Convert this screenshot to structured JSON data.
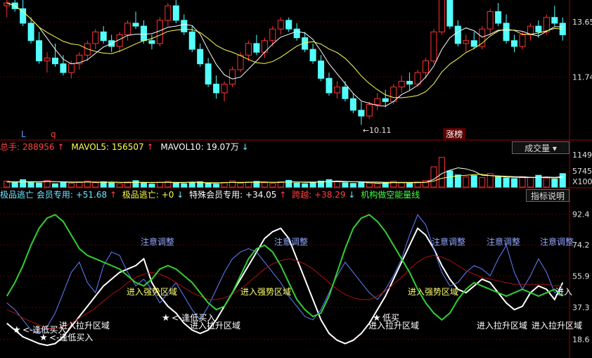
{
  "colors": {
    "up": "#ff3232",
    "down": "#54ffff",
    "ma_white": "#ffffff",
    "ma_yellow": "#ffff50",
    "green": "#30d030",
    "blue": "#6080ff",
    "dark_red": "#b01010",
    "grid": "#5a0000",
    "text_axis": "#e0e0e0"
  },
  "price_panel": {
    "axis_labels": [
      "13.65",
      "11.74"
    ],
    "low_annotation": "10.11",
    "markers": [
      "L",
      "q",
      "L"
    ],
    "badge": "涨榜"
  },
  "volume_panel": {
    "header": {
      "hand_label": "总手:",
      "hand_value": "288956",
      "mavol5_label": "MAVOL5:",
      "mavol5_value": "156507",
      "mavol10_label": "MAVOL10:",
      "mavol10_value": "19.07万"
    },
    "dropdown_label": "成交量",
    "dropdown_icon": "chevron-down",
    "axis_labels": [
      "1149",
      "5745",
      "X100"
    ]
  },
  "indicator_panel": {
    "header": {
      "item1_label": "极品逃亡",
      "item2_label": "会员专用:",
      "item2_value": "+51.68",
      "item3_label": "极品逃亡:",
      "item3_value": "+0",
      "item4_label": "特殊会员专用:",
      "item4_value": "+34.05",
      "item5_label": "跨越:",
      "item5_value": "+38.29",
      "item6_label": "机构做空能量线"
    },
    "help_button": "指标说明",
    "axis_labels": [
      "92.4",
      "74.2",
      "55.9",
      "37.3",
      "18.6"
    ],
    "annotations": {
      "attention": "注意调整",
      "strong_zone": "进入强势区域",
      "pull_up_zone": "进入拉升区域",
      "low_buy_1": "逢低买入",
      "low_buy_2": "<-逢低买入",
      "low_buy_3": "<-逢低买入",
      "low_buy_4": "低买",
      "enter_short": "进入",
      "enter_cut": "进入拉升区域",
      "overflow_text": "进入拉升区域"
    }
  },
  "chart_data": [
    {
      "type": "candlestick",
      "title": "",
      "y_ticks": [
        13.65,
        11.74
      ],
      "ylim": [
        9.6,
        14.4
      ],
      "annotated_low": 10.11,
      "note": "daily candles with moving averages; values estimated",
      "candles": [
        [
          14.2,
          14.5,
          13.8,
          14.3
        ],
        [
          14.3,
          14.6,
          14.0,
          14.1
        ],
        [
          14.1,
          14.4,
          13.5,
          13.6
        ],
        [
          13.6,
          13.8,
          12.9,
          13.0
        ],
        [
          13.0,
          13.3,
          12.2,
          12.3
        ],
        [
          12.3,
          12.6,
          11.9,
          12.4
        ],
        [
          12.4,
          12.9,
          12.1,
          12.2
        ],
        [
          12.2,
          12.5,
          11.8,
          11.9
        ],
        [
          11.9,
          12.3,
          11.7,
          12.2
        ],
        [
          12.2,
          12.6,
          12.0,
          12.5
        ],
        [
          12.5,
          13.0,
          12.3,
          12.9
        ],
        [
          12.9,
          13.4,
          12.7,
          13.3
        ],
        [
          13.3,
          13.5,
          12.9,
          13.0
        ],
        [
          13.0,
          13.2,
          12.6,
          12.8
        ],
        [
          12.8,
          13.3,
          12.6,
          13.2
        ],
        [
          13.2,
          13.7,
          13.0,
          13.6
        ],
        [
          13.6,
          14.0,
          13.4,
          13.5
        ],
        [
          13.5,
          13.7,
          12.9,
          13.0
        ],
        [
          13.0,
          13.2,
          12.7,
          12.9
        ],
        [
          12.9,
          13.8,
          12.8,
          13.7
        ],
        [
          13.7,
          14.3,
          13.5,
          14.2
        ],
        [
          14.2,
          14.4,
          13.6,
          13.7
        ],
        [
          13.7,
          13.9,
          13.2,
          13.3
        ],
        [
          13.3,
          13.5,
          12.6,
          12.7
        ],
        [
          12.7,
          12.9,
          12.1,
          12.2
        ],
        [
          12.2,
          12.4,
          11.4,
          11.5
        ],
        [
          11.5,
          11.8,
          11.0,
          11.2
        ],
        [
          11.2,
          11.6,
          10.9,
          11.5
        ],
        [
          11.5,
          12.1,
          11.4,
          12.0
        ],
        [
          12.0,
          12.6,
          11.9,
          12.5
        ],
        [
          12.5,
          13.0,
          12.3,
          12.9
        ],
        [
          12.9,
          13.2,
          12.5,
          12.6
        ],
        [
          12.6,
          13.1,
          12.4,
          13.0
        ],
        [
          13.0,
          13.5,
          12.8,
          13.4
        ],
        [
          13.4,
          13.8,
          13.2,
          13.7
        ],
        [
          13.7,
          13.8,
          13.3,
          13.4
        ],
        [
          13.4,
          13.6,
          13.0,
          13.1
        ],
        [
          13.1,
          13.3,
          12.6,
          12.7
        ],
        [
          12.7,
          12.9,
          12.2,
          12.3
        ],
        [
          12.3,
          12.5,
          11.6,
          11.7
        ],
        [
          11.7,
          11.9,
          11.1,
          11.2
        ],
        [
          11.2,
          11.6,
          11.0,
          11.4
        ],
        [
          11.4,
          11.6,
          10.9,
          11.0
        ],
        [
          11.0,
          11.2,
          10.5,
          10.6
        ],
        [
          10.6,
          10.9,
          10.1,
          10.4
        ],
        [
          10.4,
          10.9,
          10.3,
          10.8
        ],
        [
          10.8,
          11.2,
          10.6,
          11.0
        ],
        [
          11.0,
          11.3,
          10.7,
          10.9
        ],
        [
          10.9,
          11.5,
          10.8,
          11.4
        ],
        [
          11.4,
          11.8,
          11.2,
          11.6
        ],
        [
          11.6,
          11.9,
          11.3,
          11.5
        ],
        [
          11.5,
          12.0,
          11.4,
          11.9
        ],
        [
          11.9,
          12.4,
          11.7,
          12.3
        ],
        [
          12.3,
          13.4,
          12.2,
          13.3
        ],
        [
          13.3,
          14.6,
          13.2,
          14.5
        ],
        [
          14.5,
          14.6,
          13.4,
          13.5
        ],
        [
          13.5,
          13.7,
          12.8,
          12.9
        ],
        [
          12.9,
          13.2,
          12.6,
          13.0
        ],
        [
          13.0,
          13.3,
          12.7,
          12.8
        ],
        [
          12.8,
          13.5,
          12.7,
          13.4
        ],
        [
          13.4,
          14.1,
          13.2,
          14.0
        ],
        [
          14.0,
          14.3,
          13.5,
          13.6
        ],
        [
          13.6,
          13.9,
          12.9,
          13.0
        ],
        [
          13.0,
          13.2,
          12.6,
          12.8
        ],
        [
          12.8,
          13.3,
          12.7,
          13.2
        ],
        [
          13.2,
          13.6,
          13.0,
          13.5
        ],
        [
          13.5,
          13.7,
          13.1,
          13.3
        ],
        [
          13.3,
          13.9,
          13.2,
          13.8
        ],
        [
          13.8,
          14.2,
          13.5,
          13.6
        ],
        [
          13.6,
          13.8,
          13.0,
          13.2
        ]
      ]
    },
    {
      "type": "bar",
      "title": "成交量",
      "y_ticks": [
        1149,
        5745
      ],
      "unit": "X100",
      "values": [
        18,
        14,
        22,
        16,
        12,
        20,
        10,
        15,
        11,
        14,
        18,
        13,
        16,
        12,
        10,
        15,
        19,
        13,
        9,
        14,
        17,
        12,
        10,
        13,
        16,
        11,
        9,
        14,
        18,
        12,
        15,
        17,
        13,
        11,
        16,
        20,
        12,
        10,
        14,
        18,
        22,
        16,
        13,
        11,
        15,
        12,
        10,
        14,
        17,
        13,
        11,
        15,
        19,
        60,
        88,
        48,
        36,
        30,
        34,
        28,
        40,
        32,
        27,
        25,
        30,
        29,
        35,
        27,
        24,
        40
      ],
      "ma_series": [
        {
          "name": "MAVOL5",
          "values": [
            16,
            16,
            16,
            16,
            16,
            17,
            16,
            15,
            14,
            14,
            15,
            14,
            14,
            15,
            14,
            13,
            14,
            14,
            13,
            14,
            14,
            13,
            13,
            15,
            14,
            12,
            12,
            13,
            14,
            13,
            14,
            15,
            15,
            14,
            14,
            16,
            15,
            14,
            14,
            15,
            17,
            18,
            17,
            16,
            15,
            13,
            12,
            12,
            13,
            13,
            13,
            13,
            14,
            23,
            40,
            50,
            57,
            54,
            47,
            35,
            34,
            33,
            32,
            31,
            31,
            29,
            29,
            30,
            29,
            31
          ]
        },
        {
          "name": "MAVOL10",
          "values": [
            15,
            15,
            15,
            15,
            15,
            16,
            16,
            16,
            15,
            15,
            15,
            15,
            14,
            14,
            14,
            14,
            14,
            14,
            14,
            14,
            14,
            14,
            14,
            14,
            14,
            13,
            13,
            13,
            14,
            14,
            14,
            14,
            14,
            14,
            14,
            15,
            15,
            15,
            15,
            15,
            16,
            16,
            16,
            16,
            16,
            15,
            15,
            14,
            14,
            14,
            14,
            14,
            14,
            18,
            26,
            30,
            33,
            35,
            37,
            38,
            34,
            32,
            30,
            29,
            28,
            28,
            28,
            28,
            27,
            28
          ]
        }
      ]
    },
    {
      "type": "line",
      "title": "极品逃亡",
      "y_ticks": [
        92.4,
        74.2,
        55.9,
        37.3,
        18.6
      ],
      "ylim": [
        10,
        100
      ],
      "series": [
        {
          "name": "会员专用",
          "color": "#ffffff",
          "values": [
            28,
            24,
            20,
            18,
            16,
            15,
            16,
            20,
            26,
            32,
            38,
            44,
            50,
            54,
            58,
            60,
            62,
            66,
            52,
            44,
            38,
            34,
            28,
            24,
            22,
            24,
            30,
            38,
            46,
            54,
            62,
            70,
            78,
            82,
            84,
            78,
            66,
            54,
            42,
            30,
            22,
            18,
            16,
            18,
            22,
            28,
            36,
            44,
            54,
            64,
            74,
            84,
            80,
            72,
            62,
            54,
            48,
            46,
            50,
            54,
            52,
            46,
            40,
            36,
            38,
            46,
            50,
            48,
            42,
            52
          ]
        },
        {
          "name": "特殊会员专用",
          "color": "#6080ff",
          "values": [
            40,
            36,
            30,
            24,
            22,
            26,
            34,
            46,
            58,
            64,
            52,
            46,
            62,
            70,
            68,
            58,
            50,
            54,
            48,
            40,
            46,
            52,
            44,
            36,
            30,
            38,
            48,
            58,
            66,
            70,
            72,
            70,
            64,
            58,
            52,
            44,
            38,
            32,
            30,
            36,
            46,
            56,
            64,
            58,
            52,
            46,
            42,
            48,
            56,
            66,
            80,
            92,
            86,
            72,
            58,
            50,
            52,
            58,
            62,
            60,
            56,
            66,
            74,
            58,
            48,
            56,
            66,
            58,
            46,
            48
          ]
        },
        {
          "name": "跨越",
          "color": "#b01010",
          "values": [
            36,
            34,
            31,
            29,
            27,
            25,
            25,
            26,
            28,
            31,
            34,
            37,
            41,
            45,
            48,
            52,
            55,
            57,
            58,
            57,
            55,
            52,
            49,
            46,
            44,
            42,
            42,
            43,
            45,
            48,
            52,
            56,
            60,
            63,
            65,
            66,
            65,
            63,
            60,
            56,
            52,
            48,
            45,
            43,
            42,
            42,
            44,
            47,
            51,
            55,
            60,
            64,
            67,
            68,
            67,
            65,
            62,
            59,
            57,
            55,
            54,
            53,
            52,
            51,
            51,
            51,
            51,
            51,
            50,
            50
          ]
        },
        {
          "name": "机构做空能量线",
          "color": "#30d030",
          "values": [
            44,
            52,
            62,
            74,
            84,
            90,
            92,
            88,
            80,
            72,
            68,
            66,
            64,
            62,
            60,
            56,
            52,
            50,
            54,
            60,
            62,
            60,
            56,
            52,
            46,
            40,
            36,
            38,
            46,
            56,
            66,
            72,
            74,
            70,
            62,
            52,
            42,
            36,
            32,
            34,
            44,
            58,
            72,
            84,
            90,
            92,
            88,
            82,
            74,
            66,
            58,
            48,
            40,
            34,
            30,
            34,
            42,
            48,
            52,
            50,
            48,
            46,
            44,
            46,
            48,
            46,
            44,
            46,
            48,
            44
          ]
        }
      ]
    }
  ]
}
